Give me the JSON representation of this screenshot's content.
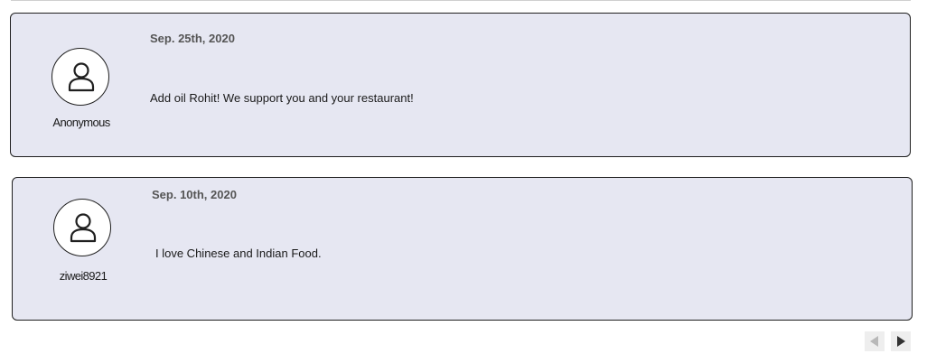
{
  "comments": [
    {
      "username": "Anonymous",
      "date": "Sep. 25th, 2020",
      "text": "Add oil Rohit! We support you and your restaurant!",
      "avatar_icon": "user-icon"
    },
    {
      "username": "ziwei8921",
      "date": "Sep. 10th, 2020",
      "text": "I love Chinese and Indian Food.",
      "avatar_icon": "user-icon"
    }
  ],
  "pagination": {
    "prev_icon": "triangle-left-icon",
    "next_icon": "triangle-right-icon",
    "prev_color": "#b8b8b8",
    "next_color": "#333333"
  },
  "colors": {
    "card_background": "#e6e7f2",
    "card_border": "#1f1f1f",
    "date_text": "#555555"
  }
}
